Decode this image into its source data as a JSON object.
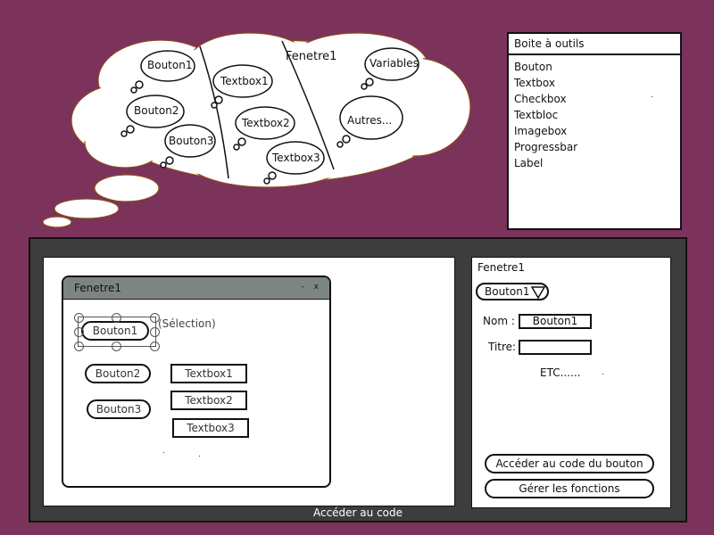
{
  "cloud": {
    "section_title": "Fenetre1",
    "buttons": [
      "Bouton1",
      "Bouton2",
      "Bouton3"
    ],
    "textboxes": [
      "Textbox1",
      "Textbox2",
      "Textbox3"
    ],
    "others": [
      "Variables",
      "Autres..."
    ]
  },
  "toolbox": {
    "title": "Boite à outils",
    "items": [
      "Bouton",
      "Textbox",
      "Checkbox",
      "Textbloc",
      "Imagebox",
      "Progressbar",
      "Label"
    ]
  },
  "designer": {
    "window_title": "Fenetre1",
    "window_controls": "- x",
    "selection_label": "(Sélection)",
    "buttons": [
      "Bouton1",
      "Bouton2",
      "Bouton3"
    ],
    "textboxes": [
      "Textbox1",
      "Textbox2",
      "Textbox3"
    ]
  },
  "properties": {
    "title": "Fenetre1",
    "selected_control": "Bouton1",
    "name_label": "Nom :",
    "name_value": "Bouton1",
    "title_label": "Titre:",
    "title_value": "",
    "etc": "ETC......",
    "code_button": "Accéder au code du bouton",
    "functions_button": "Gérer les fonctions"
  },
  "footer": {
    "code_link": "Accéder au code"
  }
}
